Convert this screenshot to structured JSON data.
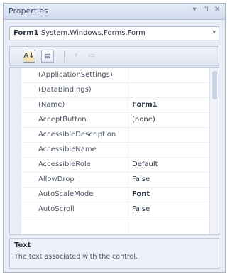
{
  "window": {
    "title": "Properties",
    "controls": [
      "▾",
      "⊓",
      "✕"
    ]
  },
  "object_selector": {
    "name": "Form1",
    "type": "System.Windows.Forms.Form",
    "arrow": "▾"
  },
  "toolbar": {
    "categorized_icon": "categorized-icon",
    "alphabetical_icon": "alphabetical-icon",
    "properties_icon": "properties-icon",
    "events_icon": "events-icon"
  },
  "properties": [
    {
      "name": "(ApplicationSettings)",
      "value": "",
      "bold": false
    },
    {
      "name": "(DataBindings)",
      "value": "",
      "bold": false
    },
    {
      "name": "(Name)",
      "value": "Form1",
      "bold": true
    },
    {
      "name": "AcceptButton",
      "value": "(none)",
      "bold": false
    },
    {
      "name": "AccessibleDescription",
      "value": "",
      "bold": false
    },
    {
      "name": "AccessibleName",
      "value": "",
      "bold": false
    },
    {
      "name": "AccessibleRole",
      "value": "Default",
      "bold": false
    },
    {
      "name": "AllowDrop",
      "value": "False",
      "bold": false
    },
    {
      "name": "AutoScaleMode",
      "value": "Font",
      "bold": true
    },
    {
      "name": "AutoScroll",
      "value": "False",
      "bold": false
    }
  ],
  "description": {
    "title": "Text",
    "text": "The text associated with the control."
  }
}
